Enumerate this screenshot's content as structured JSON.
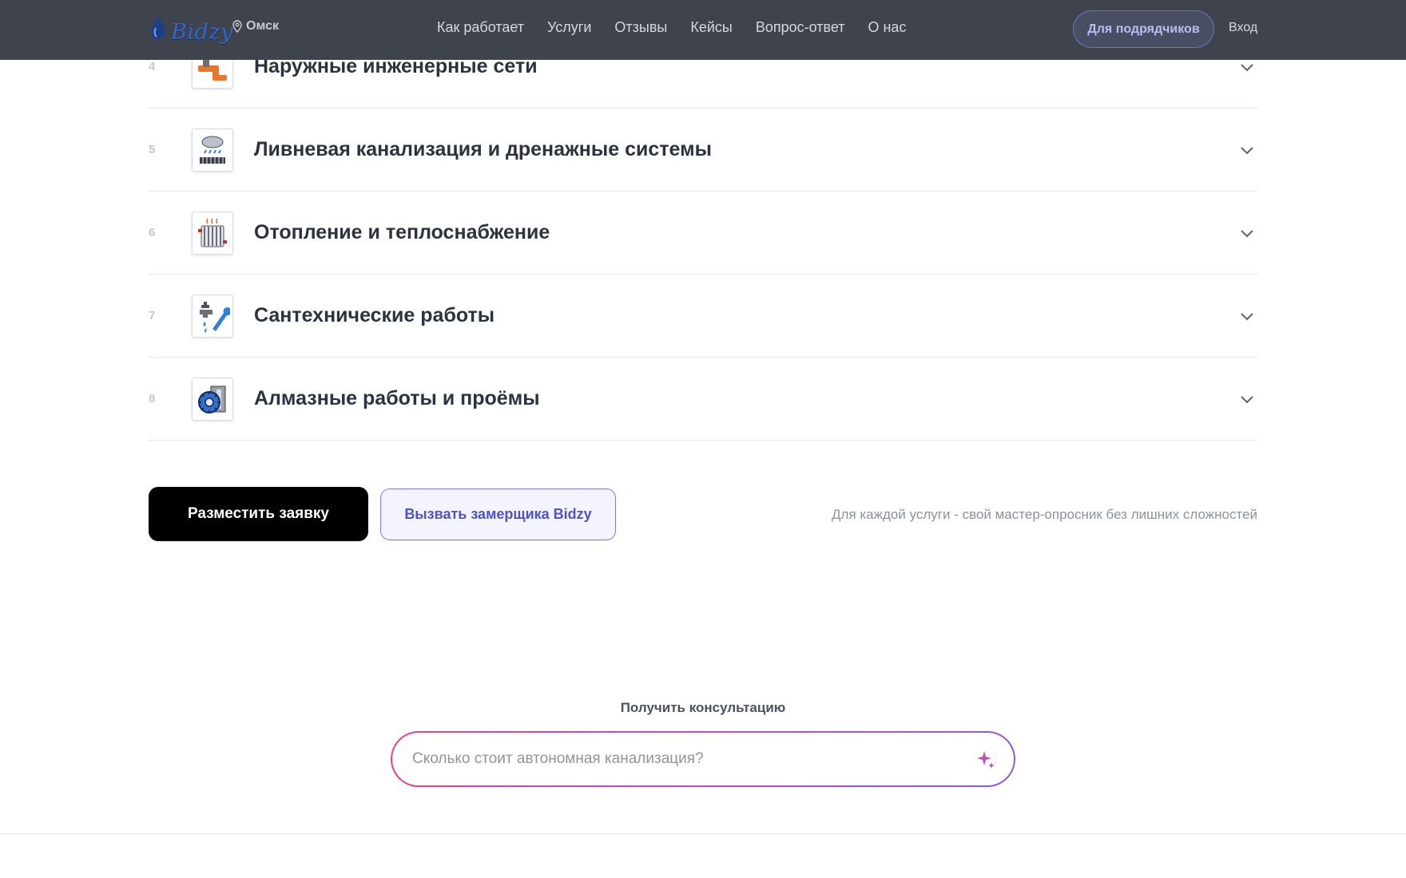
{
  "header": {
    "logo_text": "Bidzy",
    "city": "Омск",
    "nav": [
      "Как работает",
      "Услуги",
      "Отзывы",
      "Кейсы",
      "Вопрос-ответ",
      "О нас"
    ],
    "contractor_button": "Для подрядчиков",
    "login": "Вход"
  },
  "services": [
    {
      "num": "4",
      "title": "Наружные инженерные сети",
      "icon": "pipe-icon"
    },
    {
      "num": "5",
      "title": "Ливневая канализация и дренажные системы",
      "icon": "rain-drainage-icon"
    },
    {
      "num": "6",
      "title": "Отопление и теплоснабжение",
      "icon": "radiator-icon"
    },
    {
      "num": "7",
      "title": "Сантехнические работы",
      "icon": "faucet-wrench-icon"
    },
    {
      "num": "8",
      "title": "Алмазные работы и проёмы",
      "icon": "diamond-saw-icon"
    }
  ],
  "actions": {
    "primary": "Разместить заявку",
    "secondary": "Вызвать замерщика Bidzy",
    "hint": "Для каждой услуги - свой мастер-опросник без лишних сложностей"
  },
  "consult": {
    "label": "Получить консультацию",
    "placeholder": "Сколько стоит автономная канализация?"
  },
  "colors": {
    "header_bg": "#3f444c",
    "accent": "#4e53c9",
    "gradient_start": "#ee3f8a",
    "gradient_end": "#8a59e8"
  }
}
